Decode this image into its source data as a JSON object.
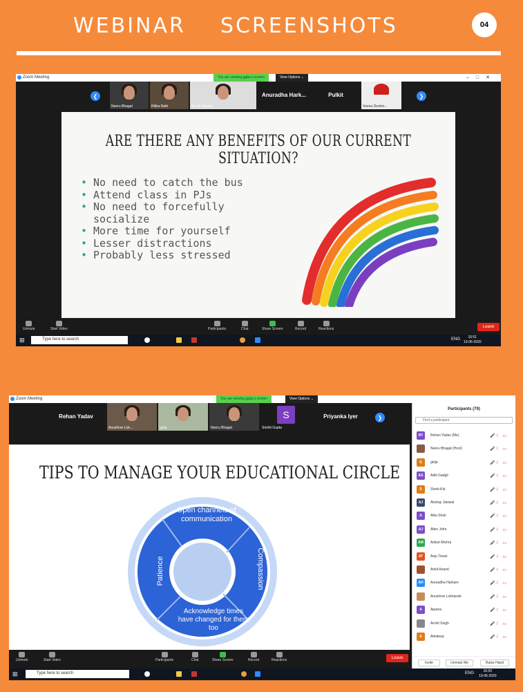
{
  "header": {
    "title": "WEBINAR    SCREENSHOTS",
    "page_number": "04"
  },
  "shot1": {
    "window_title": "Zoom Meeting",
    "banner": "You are viewing ggba s screen",
    "view_options": "View Options ⌄",
    "gallery": [
      {
        "name": "Neeru Bhagat",
        "type": "video"
      },
      {
        "name": "Ritika Nath",
        "type": "video"
      },
      {
        "name": "Shruti Mandal",
        "type": "video"
      },
      {
        "name": "Anuradha Hark...",
        "type": "name"
      },
      {
        "name": "Pulkit",
        "type": "name"
      },
      {
        "name": "Veena Deshm...",
        "type": "video"
      }
    ],
    "slide": {
      "title": "ARE THERE ANY BENEFITS OF OUR CURRENT SITUATION?",
      "bullets": [
        "No need to catch the bus",
        "Attend class in PJs",
        "No need to forcefully socialize",
        "More time for yourself",
        "Lesser distractions",
        "Probably less stressed"
      ]
    },
    "toolbar": {
      "unmute": "Unmute",
      "start_video": "Start Video",
      "participants": "Participants",
      "participants_count": "80",
      "chat": "Chat",
      "share_screen": "Share Screen",
      "record": "Record",
      "reactions": "Reactions",
      "leave": "Leave"
    },
    "taskbar": {
      "search_placeholder": "Type here to search",
      "lang": "ENG",
      "time": "16:51",
      "date": "13-06-2020"
    }
  },
  "shot2": {
    "window_title": "Zoom Meeting",
    "banner": "You are viewing ggba s screen",
    "view_options": "View Options ⌄",
    "gallery": [
      {
        "name": "Rehan Yadav",
        "type": "name"
      },
      {
        "name": "Anushree Lok...",
        "type": "video"
      },
      {
        "name": "girija",
        "type": "video"
      },
      {
        "name": "Neeru Bhagat",
        "type": "video"
      },
      {
        "name": "Srishti Gupta",
        "type": "avatar",
        "initial": "S"
      },
      {
        "name": "Priyanka Iyer",
        "type": "name"
      }
    ],
    "slide": {
      "title": "TIPS TO MANAGE YOUR EDUCATIONAL CIRCLE",
      "segments": {
        "top": "Open channels of communication",
        "right": "Compassion",
        "bottom": "Acknowledge times have changed for them too",
        "left": "Patience"
      }
    },
    "panel": {
      "title": "Participants (79)",
      "find_placeholder": "Find a participant",
      "participants": [
        {
          "initials": "RY",
          "name": "Rehan Yadav (Me)",
          "color": "#7b4fc9"
        },
        {
          "initials": "",
          "name": "Neeru Bhagat (Host)",
          "color": "#8a5a44"
        },
        {
          "initials": "G",
          "name": "girija",
          "color": "#e07b17"
        },
        {
          "initials": "AG",
          "name": "Aditi Gadgil",
          "color": "#7b4fc9"
        },
        {
          "initials": "S",
          "name": "Shebi Kib",
          "color": "#e07b17"
        },
        {
          "initials": "AJ",
          "name": "Akshay Jaiswal",
          "color": "#3b4a6b"
        },
        {
          "initials": "A",
          "name": "Alka Shah",
          "color": "#7b4fc9"
        },
        {
          "initials": "AJ",
          "name": "Allen John",
          "color": "#7b4fc9"
        },
        {
          "initials": "AM",
          "name": "Aniket Mishra",
          "color": "#2fa84f"
        },
        {
          "initials": "AT",
          "name": "Anju Tiwari",
          "color": "#e0531c"
        },
        {
          "initials": "",
          "name": "Ankit Anand",
          "color": "#a0522d"
        },
        {
          "initials": "AH",
          "name": "Anuradha Harkare",
          "color": "#2d8cff"
        },
        {
          "initials": "",
          "name": "Anushree Lokhande",
          "color": "#c98a5a"
        },
        {
          "initials": "A",
          "name": "Aparna",
          "color": "#7b4fc9"
        },
        {
          "initials": "",
          "name": "Archit Singh",
          "color": "#888888"
        },
        {
          "initials": "A",
          "name": "Atindeep",
          "color": "#e07b17"
        }
      ],
      "buttons": {
        "invite": "Invite",
        "unmute": "Unmute Me",
        "raise": "Raise Hand"
      }
    },
    "toolbar": {
      "unmute": "Unmute",
      "start_video": "Start Video",
      "participants": "Participants",
      "participants_count": "79",
      "chat": "Chat",
      "share_screen": "Share Screen",
      "record": "Record",
      "reactions": "Reactions",
      "leave": "Leave"
    },
    "taskbar": {
      "search_placeholder": "Type here to search",
      "lang": "ENG",
      "time": "16:50",
      "date": "13-06-2020"
    }
  }
}
